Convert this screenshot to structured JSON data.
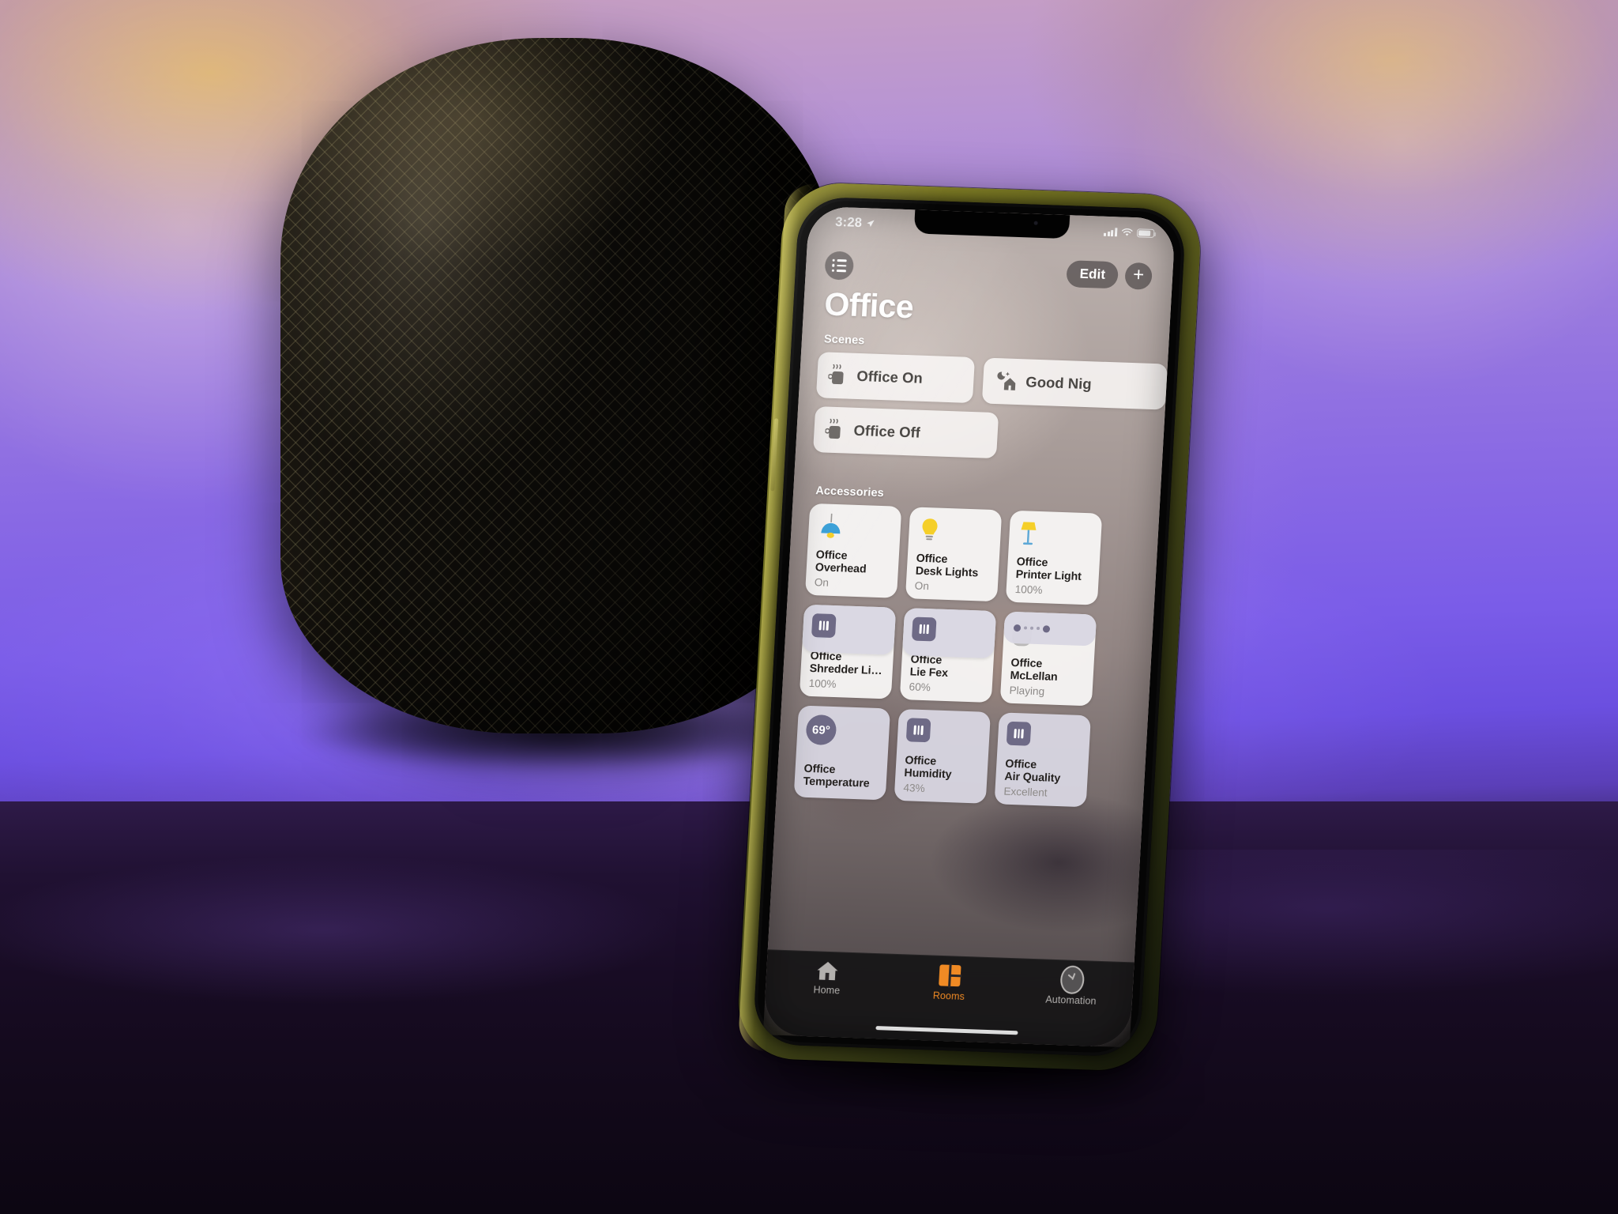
{
  "photo": {
    "subject": "HomePod with iPhone leaning against it",
    "device_label": "homepod-speaker",
    "phone_case_color": "#6a6a20",
    "background_colors": [
      "#b794d4",
      "#7a5ce8",
      "#ddb060",
      "#140d22"
    ]
  },
  "status_bar": {
    "time": "3:28",
    "location_icon": "location-arrow-icon",
    "cellular_icon": "signal-bars-icon",
    "wifi_icon": "wifi-icon",
    "battery_icon": "battery-icon"
  },
  "nav": {
    "list_icon": "list-bullet-icon",
    "edit_label": "Edit",
    "add_label": "+"
  },
  "header": {
    "room_title": "Office"
  },
  "sections": {
    "scenes_label": "Scenes",
    "accessories_label": "Accessories"
  },
  "scenes": [
    {
      "name": "Office On",
      "icon": "coffee-cup-icon"
    },
    {
      "name": "Good Nig",
      "icon": "moon-house-icon"
    },
    {
      "name": "Office Off",
      "icon": "coffee-cup-icon"
    }
  ],
  "accessories": [
    {
      "name": "Office\nOverhead",
      "name_line1": "Office",
      "name_line2": "Overhead",
      "state": "On",
      "icon": "pendant-light-icon",
      "icon_color": "#3aa0d8",
      "kind": "light"
    },
    {
      "name": "Office\nDesk Lights",
      "name_line1": "Office",
      "name_line2": "Desk Lights",
      "state": "On",
      "icon": "light-bulb-icon",
      "icon_color": "#f5cf29",
      "kind": "light"
    },
    {
      "name": "Office\nPrinter Light",
      "name_line1": "Office",
      "name_line2": "Printer Light",
      "state": "100%",
      "icon": "floor-lamp-icon",
      "icon_color": "#f5cf29",
      "kind": "light"
    },
    {
      "name": "Office\nShredder Li…",
      "name_line1": "Office",
      "name_line2": "Shredder Li…",
      "state": "100%",
      "icon": "floor-lamp-icon",
      "icon_color": "#f5cf29",
      "kind": "light"
    },
    {
      "name": "Office\nLie Fex",
      "name_line1": "Office",
      "name_line2": "Lie Fex",
      "state": "60%",
      "icon": "desk-lamp-icon",
      "icon_color": "#3aa0d8",
      "kind": "light"
    },
    {
      "name": "Office\nMcLellan",
      "name_line1": "Office",
      "name_line2": "McLellan",
      "state": "Playing",
      "icon": "homepod-speaker-icon",
      "icon_color": "#d9d7d7",
      "kind": "speaker"
    },
    {
      "name": "Office\nTemperature",
      "name_line1": "Office",
      "name_line2": "Temperature",
      "state": "",
      "icon": "temperature-icon",
      "icon_color": "#6e6a86",
      "kind": "sensor",
      "badge": "69°"
    },
    {
      "name": "Office\nHumidity",
      "name_line1": "Office",
      "name_line2": "Humidity",
      "state": "43%",
      "icon": "sensor-icon",
      "icon_color": "#6e6a86",
      "kind": "sensor"
    },
    {
      "name": "Office\nAir Quality",
      "name_line1": "Office",
      "name_line2": "Air Quality",
      "state": "Excellent",
      "icon": "sensor-icon",
      "icon_color": "#6e6a86",
      "kind": "sensor"
    }
  ],
  "tabs": [
    {
      "label": "Home",
      "icon": "house-icon",
      "active": false
    },
    {
      "label": "Rooms",
      "icon": "rooms-icon",
      "active": true
    },
    {
      "label": "Automation",
      "icon": "clock-icon",
      "active": false
    }
  ],
  "accent_color": "#f08a24"
}
